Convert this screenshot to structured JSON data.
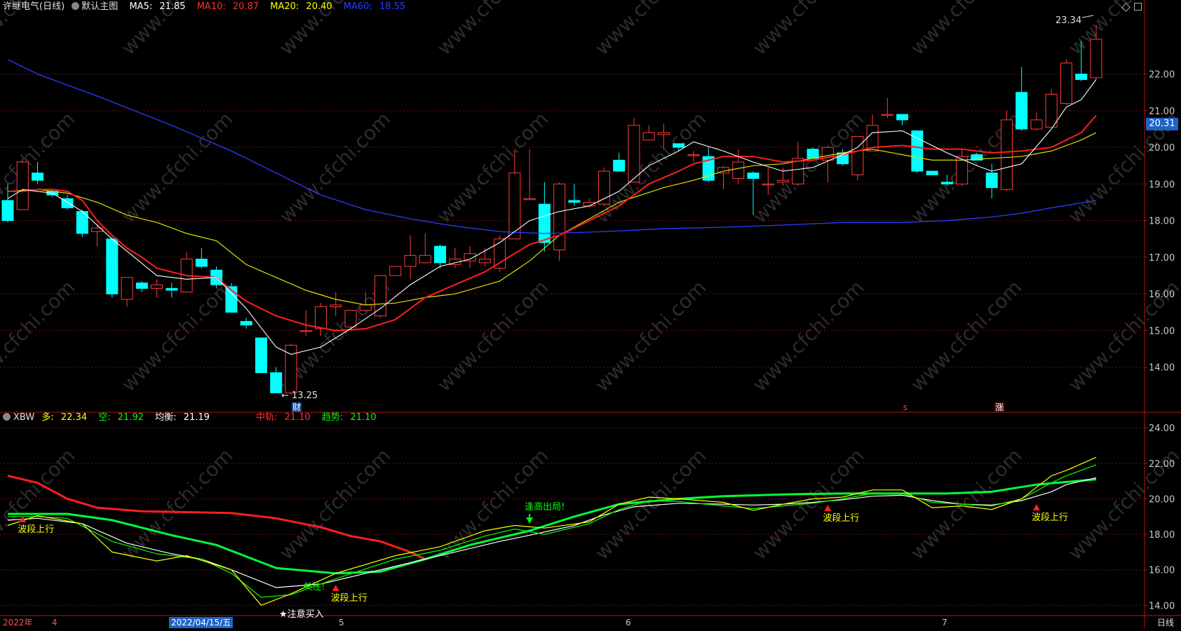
{
  "stock": {
    "name": "许继电气(日线)",
    "template": "默认主图"
  },
  "ma": [
    {
      "label": "MA5:",
      "value": "21.85",
      "color": "#ffffff"
    },
    {
      "label": "MA10:",
      "value": "20.87",
      "color": "#ff3030"
    },
    {
      "label": "MA20:",
      "value": "20.40",
      "color": "#ffff00"
    },
    {
      "label": "MA60:",
      "value": "18.55",
      "color": "#2a3cff"
    }
  ],
  "xbw": {
    "name": "XBW",
    "items": [
      {
        "label": "多:",
        "value": "22.34",
        "color": "#ffff00"
      },
      {
        "label": "空:",
        "value": "21.92",
        "color": "#00ff00"
      },
      {
        "label": "均衡:",
        "value": "21.19",
        "color": "#ffffff"
      },
      {
        "label": "中轨:",
        "value": "21.10",
        "color": "#ff3030"
      },
      {
        "label": "趋势:",
        "value": "21.10",
        "color": "#00ff00"
      }
    ]
  },
  "price_axis": [
    "22.00",
    "21.00",
    "20.00",
    "19.00",
    "18.00",
    "17.00",
    "16.00",
    "15.00",
    "14.00"
  ],
  "current_price": "20.31",
  "indicator_axis": [
    "24.00",
    "22.00",
    "20.00",
    "18.00",
    "16.00",
    "14.00"
  ],
  "annotations": {
    "high": "23.34",
    "low": "← 13.25",
    "cai": "财",
    "zhang": "涨",
    "s_mark": "s",
    "bo_duan": "波段上行",
    "feng_gao": "逢高出局!",
    "guan_zhu": "关注!",
    "zhu_yi_mai_ru": "★注意买入"
  },
  "time_axis": {
    "year": "2022年",
    "m4": "4",
    "m5": "5",
    "m6": "6",
    "m7": "7",
    "cursor_date": "2022/04/15/五",
    "period_button": "日线"
  },
  "watermark": "www.cfchi.com",
  "chart_data": {
    "type": "candlestick",
    "price_range": [
      13.0,
      23.6
    ],
    "candles": [
      [
        18.55,
        19.0,
        17.95,
        18.0
      ],
      [
        18.3,
        19.7,
        18.3,
        19.6
      ],
      [
        19.3,
        19.6,
        19.0,
        19.1
      ],
      [
        18.8,
        18.85,
        18.65,
        18.7
      ],
      [
        18.6,
        18.7,
        18.3,
        18.35
      ],
      [
        18.25,
        18.3,
        17.55,
        17.65
      ],
      [
        17.7,
        17.9,
        17.3,
        17.8
      ],
      [
        17.5,
        17.55,
        15.9,
        16.0
      ],
      [
        15.85,
        16.45,
        15.65,
        16.45
      ],
      [
        16.3,
        16.35,
        16.05,
        16.15
      ],
      [
        16.15,
        16.4,
        15.9,
        16.25
      ],
      [
        16.15,
        16.3,
        15.9,
        16.1
      ],
      [
        16.05,
        17.15,
        16.05,
        16.95
      ],
      [
        16.95,
        17.25,
        16.7,
        16.75
      ],
      [
        16.65,
        16.75,
        16.15,
        16.25
      ],
      [
        16.2,
        16.3,
        15.5,
        15.5
      ],
      [
        15.25,
        15.35,
        15.05,
        15.15
      ],
      [
        14.8,
        14.8,
        13.85,
        13.85
      ],
      [
        13.85,
        14.0,
        13.3,
        13.3
      ],
      [
        13.3,
        14.65,
        13.25,
        14.6
      ],
      [
        15.0,
        15.55,
        14.85,
        15.0
      ],
      [
        15.05,
        15.75,
        14.85,
        15.65
      ],
      [
        15.65,
        16.05,
        15.4,
        15.7
      ],
      [
        15.1,
        15.55,
        15.0,
        15.55
      ],
      [
        15.55,
        16.05,
        15.5,
        15.7
      ],
      [
        15.4,
        16.45,
        15.35,
        16.5
      ],
      [
        16.5,
        16.75,
        16.5,
        16.75
      ],
      [
        16.75,
        17.6,
        16.4,
        17.05
      ],
      [
        16.85,
        17.65,
        16.85,
        17.05
      ],
      [
        17.3,
        17.35,
        16.7,
        16.85
      ],
      [
        16.8,
        17.25,
        16.7,
        16.95
      ],
      [
        16.9,
        17.3,
        16.7,
        17.1
      ],
      [
        16.85,
        17.25,
        16.75,
        16.95
      ],
      [
        16.7,
        17.6,
        16.6,
        17.5
      ],
      [
        17.5,
        19.95,
        17.5,
        19.3
      ],
      [
        18.6,
        19.95,
        18.6,
        18.6
      ],
      [
        18.45,
        19.05,
        17.15,
        17.4
      ],
      [
        17.2,
        19.05,
        16.9,
        19.0
      ],
      [
        18.55,
        19.0,
        18.4,
        18.5
      ],
      [
        18.4,
        18.6,
        18.35,
        18.5
      ],
      [
        18.45,
        19.45,
        18.4,
        19.35
      ],
      [
        19.65,
        19.85,
        19.35,
        19.35
      ],
      [
        19.05,
        20.8,
        19.05,
        20.6
      ],
      [
        20.2,
        20.6,
        20.2,
        20.4
      ],
      [
        20.35,
        20.65,
        19.95,
        20.4
      ],
      [
        20.1,
        20.1,
        19.9,
        20.0
      ],
      [
        19.8,
        19.9,
        19.6,
        19.8
      ],
      [
        19.75,
        20.0,
        19.05,
        19.1
      ],
      [
        19.3,
        19.5,
        18.85,
        19.45
      ],
      [
        19.15,
        19.95,
        19.0,
        19.6
      ],
      [
        19.3,
        19.35,
        18.15,
        19.15
      ],
      [
        19.0,
        19.45,
        18.7,
        19.0
      ],
      [
        19.05,
        19.45,
        18.95,
        19.1
      ],
      [
        19.0,
        20.15,
        18.95,
        19.7
      ],
      [
        19.95,
        20.0,
        19.7,
        19.7
      ],
      [
        19.65,
        20.05,
        19.05,
        20.0
      ],
      [
        19.85,
        19.95,
        19.5,
        19.55
      ],
      [
        19.25,
        20.1,
        19.1,
        20.3
      ],
      [
        19.9,
        20.9,
        19.9,
        20.6
      ],
      [
        20.9,
        21.35,
        20.8,
        20.9
      ],
      [
        20.9,
        20.9,
        20.6,
        20.75
      ],
      [
        20.45,
        20.45,
        19.3,
        19.35
      ],
      [
        19.35,
        19.35,
        19.25,
        19.25
      ],
      [
        19.05,
        19.25,
        18.95,
        19.0
      ],
      [
        19.0,
        19.95,
        18.95,
        19.75
      ],
      [
        19.8,
        19.85,
        19.65,
        19.65
      ],
      [
        19.3,
        19.55,
        18.6,
        18.9
      ],
      [
        18.85,
        21.0,
        18.8,
        20.75
      ],
      [
        21.5,
        22.2,
        20.45,
        20.5
      ],
      [
        20.5,
        20.95,
        20.45,
        20.75
      ],
      [
        20.55,
        21.6,
        20.55,
        21.45
      ],
      [
        21.2,
        22.4,
        21.15,
        22.3
      ],
      [
        22.0,
        22.9,
        21.8,
        21.85
      ],
      [
        21.9,
        23.34,
        21.85,
        22.95
      ]
    ],
    "ma5": [
      [
        18.6,
        0
      ],
      [
        18.85,
        1
      ],
      [
        18.8,
        2
      ],
      [
        18.75,
        3
      ],
      [
        18.5,
        4
      ],
      [
        18.25,
        5
      ],
      [
        17.5,
        7
      ],
      [
        16.5,
        10
      ],
      [
        16.4,
        12
      ],
      [
        16.45,
        14
      ],
      [
        15.6,
        16
      ],
      [
        14.55,
        18
      ],
      [
        14.35,
        19
      ],
      [
        14.55,
        21
      ],
      [
        15.05,
        23
      ],
      [
        15.6,
        25
      ],
      [
        16.25,
        27
      ],
      [
        16.75,
        29
      ],
      [
        16.95,
        31
      ],
      [
        17.4,
        33
      ],
      [
        18.0,
        35
      ],
      [
        18.25,
        37
      ],
      [
        18.4,
        39
      ],
      [
        18.8,
        41
      ],
      [
        19.5,
        43
      ],
      [
        19.9,
        45
      ],
      [
        20.15,
        46
      ],
      [
        19.9,
        48
      ],
      [
        19.6,
        50
      ],
      [
        19.35,
        52
      ],
      [
        19.45,
        54
      ],
      [
        19.8,
        56
      ],
      [
        20.0,
        57
      ],
      [
        20.4,
        58
      ],
      [
        20.45,
        60
      ],
      [
        20.25,
        61
      ],
      [
        19.85,
        63
      ],
      [
        19.5,
        65
      ],
      [
        19.35,
        66
      ],
      [
        19.55,
        68
      ],
      [
        20.5,
        70
      ],
      [
        21.1,
        71
      ],
      [
        21.3,
        72
      ],
      [
        21.85,
        73
      ]
    ],
    "ma10": [
      [
        18.8,
        0
      ],
      [
        18.8,
        1
      ],
      [
        18.85,
        2
      ],
      [
        18.85,
        3
      ],
      [
        18.8,
        4
      ],
      [
        18.55,
        5
      ],
      [
        18.0,
        6
      ],
      [
        17.6,
        7
      ],
      [
        17.25,
        8
      ],
      [
        17.0,
        9
      ],
      [
        16.7,
        10
      ],
      [
        16.5,
        12
      ],
      [
        16.45,
        14
      ],
      [
        16.1,
        15
      ],
      [
        15.8,
        16
      ],
      [
        15.4,
        18
      ],
      [
        15.15,
        20
      ],
      [
        15.0,
        22
      ],
      [
        15.05,
        24
      ],
      [
        15.3,
        26
      ],
      [
        15.9,
        28
      ],
      [
        16.25,
        30
      ],
      [
        16.6,
        32
      ],
      [
        17.1,
        34
      ],
      [
        17.35,
        35
      ],
      [
        17.6,
        37
      ],
      [
        18.0,
        39
      ],
      [
        18.4,
        41
      ],
      [
        19.0,
        43
      ],
      [
        19.35,
        45
      ],
      [
        19.55,
        46
      ],
      [
        19.75,
        48
      ],
      [
        19.75,
        50
      ],
      [
        19.6,
        52
      ],
      [
        19.65,
        54
      ],
      [
        19.8,
        56
      ],
      [
        20.0,
        58
      ],
      [
        20.05,
        60
      ],
      [
        19.95,
        62
      ],
      [
        19.95,
        64
      ],
      [
        19.85,
        66
      ],
      [
        19.9,
        68
      ],
      [
        20.0,
        70
      ],
      [
        20.4,
        72
      ],
      [
        20.87,
        73
      ]
    ],
    "ma20": [
      [
        18.8,
        0
      ],
      [
        18.85,
        2
      ],
      [
        18.75,
        4
      ],
      [
        18.5,
        6
      ],
      [
        18.15,
        8
      ],
      [
        17.95,
        10
      ],
      [
        17.65,
        12
      ],
      [
        17.45,
        14
      ],
      [
        16.8,
        16
      ],
      [
        16.45,
        18
      ],
      [
        16.1,
        20
      ],
      [
        15.85,
        22
      ],
      [
        15.7,
        24
      ],
      [
        15.75,
        26
      ],
      [
        15.9,
        28
      ],
      [
        16.0,
        30
      ],
      [
        16.35,
        33
      ],
      [
        16.9,
        35
      ],
      [
        17.6,
        37
      ],
      [
        18.05,
        39
      ],
      [
        18.5,
        41
      ],
      [
        18.9,
        44
      ],
      [
        19.1,
        46
      ],
      [
        19.35,
        48
      ],
      [
        19.5,
        50
      ],
      [
        19.55,
        52
      ],
      [
        19.7,
        54
      ],
      [
        19.85,
        56
      ],
      [
        19.95,
        58
      ],
      [
        19.8,
        60
      ],
      [
        19.65,
        62
      ],
      [
        19.65,
        64
      ],
      [
        19.7,
        66
      ],
      [
        19.75,
        68
      ],
      [
        19.9,
        70
      ],
      [
        20.2,
        72
      ],
      [
        20.4,
        73
      ]
    ],
    "ma60": [
      [
        22.4,
        0
      ],
      [
        22.0,
        2
      ],
      [
        21.4,
        6
      ],
      [
        20.6,
        11
      ],
      [
        19.9,
        15
      ],
      [
        19.3,
        18
      ],
      [
        18.7,
        21
      ],
      [
        18.3,
        24
      ],
      [
        18.05,
        27
      ],
      [
        17.85,
        30
      ],
      [
        17.7,
        33
      ],
      [
        17.65,
        36
      ],
      [
        17.7,
        40
      ],
      [
        17.78,
        44
      ],
      [
        17.82,
        48
      ],
      [
        17.88,
        52
      ],
      [
        17.95,
        56
      ],
      [
        17.95,
        60
      ],
      [
        18.0,
        63
      ],
      [
        18.1,
        66
      ],
      [
        18.2,
        68
      ],
      [
        18.35,
        70
      ],
      [
        18.55,
        73
      ]
    ],
    "xbw_range": [
      13.5,
      24.8
    ],
    "xbw_duo": [
      [
        18.5,
        0
      ],
      [
        19.05,
        2
      ],
      [
        18.6,
        5
      ],
      [
        17.0,
        7
      ],
      [
        16.5,
        10
      ],
      [
        16.8,
        12
      ],
      [
        16.0,
        15
      ],
      [
        14.0,
        17
      ],
      [
        14.65,
        19
      ],
      [
        15.8,
        22
      ],
      [
        16.8,
        26
      ],
      [
        17.3,
        29
      ],
      [
        18.2,
        32
      ],
      [
        18.5,
        34
      ],
      [
        18.35,
        36
      ],
      [
        18.7,
        39
      ],
      [
        19.7,
        41
      ],
      [
        20.1,
        43
      ],
      [
        20.0,
        45
      ],
      [
        19.8,
        48
      ],
      [
        19.35,
        50
      ],
      [
        19.7,
        52
      ],
      [
        20.0,
        54
      ],
      [
        20.1,
        56
      ],
      [
        20.5,
        58
      ],
      [
        20.5,
        60
      ],
      [
        19.5,
        62
      ],
      [
        19.6,
        64
      ],
      [
        19.4,
        66
      ],
      [
        20.0,
        68
      ],
      [
        21.3,
        70
      ],
      [
        21.6,
        71
      ],
      [
        22.34,
        73
      ]
    ],
    "xbw_kong": [
      [
        19.0,
        0
      ],
      [
        19.0,
        2
      ],
      [
        18.9,
        4
      ],
      [
        17.6,
        7
      ],
      [
        16.9,
        10
      ],
      [
        16.6,
        13
      ],
      [
        15.8,
        15
      ],
      [
        14.45,
        17
      ],
      [
        14.6,
        19
      ],
      [
        15.5,
        22
      ],
      [
        16.6,
        26
      ],
      [
        17.1,
        29
      ],
      [
        17.9,
        32
      ],
      [
        18.3,
        34
      ],
      [
        18.0,
        36
      ],
      [
        18.6,
        39
      ],
      [
        19.4,
        41
      ],
      [
        19.9,
        43
      ],
      [
        19.85,
        45
      ],
      [
        19.6,
        48
      ],
      [
        19.45,
        50
      ],
      [
        19.6,
        52
      ],
      [
        19.75,
        54
      ],
      [
        20.0,
        56
      ],
      [
        20.3,
        58
      ],
      [
        20.3,
        60
      ],
      [
        19.8,
        62
      ],
      [
        19.7,
        64
      ],
      [
        19.6,
        66
      ],
      [
        20.0,
        68
      ],
      [
        20.9,
        70
      ],
      [
        21.3,
        71
      ],
      [
        21.92,
        73
      ]
    ],
    "xbw_jh": [
      [
        18.8,
        0
      ],
      [
        18.9,
        2
      ],
      [
        18.6,
        5
      ],
      [
        17.5,
        8
      ],
      [
        16.9,
        11
      ],
      [
        16.6,
        13
      ],
      [
        16.0,
        15
      ],
      [
        15.0,
        18
      ],
      [
        15.2,
        21
      ],
      [
        15.8,
        24
      ],
      [
        16.4,
        27
      ],
      [
        17.0,
        30
      ],
      [
        17.6,
        33
      ],
      [
        17.95,
        35
      ],
      [
        18.5,
        38
      ],
      [
        19.1,
        40
      ],
      [
        19.55,
        42
      ],
      [
        19.75,
        45
      ],
      [
        19.7,
        48
      ],
      [
        19.65,
        50
      ],
      [
        19.7,
        52
      ],
      [
        19.8,
        54
      ],
      [
        19.95,
        56
      ],
      [
        20.15,
        58
      ],
      [
        20.2,
        60
      ],
      [
        19.9,
        62
      ],
      [
        19.7,
        64
      ],
      [
        19.65,
        66
      ],
      [
        19.9,
        68
      ],
      [
        20.4,
        70
      ],
      [
        20.8,
        71
      ],
      [
        21.19,
        73
      ]
    ],
    "xbw_zg": [
      [
        21.3,
        0
      ],
      [
        20.9,
        2
      ],
      [
        20.0,
        4
      ],
      [
        19.5,
        6
      ],
      [
        19.3,
        9
      ],
      [
        19.25,
        12
      ],
      [
        19.2,
        15
      ],
      [
        18.9,
        18
      ],
      [
        18.4,
        21
      ],
      [
        17.9,
        23
      ],
      [
        17.6,
        25
      ],
      [
        17.0,
        27
      ],
      [
        16.6,
        28
      ]
    ],
    "xbw_qs": [
      [
        19.15,
        0
      ],
      [
        19.15,
        4
      ],
      [
        18.8,
        7
      ],
      [
        17.95,
        11
      ],
      [
        17.4,
        14
      ],
      [
        16.1,
        18
      ],
      [
        15.8,
        22
      ],
      [
        15.9,
        25
      ],
      [
        16.6,
        28
      ],
      [
        17.4,
        31
      ],
      [
        18.2,
        35
      ],
      [
        19.0,
        38
      ],
      [
        19.7,
        41
      ],
      [
        20.0,
        45
      ],
      [
        20.15,
        48
      ],
      [
        20.25,
        52
      ],
      [
        20.3,
        56
      ],
      [
        20.3,
        60
      ],
      [
        20.3,
        63
      ],
      [
        20.4,
        66
      ],
      [
        20.8,
        69
      ],
      [
        21.1,
        73
      ]
    ]
  }
}
